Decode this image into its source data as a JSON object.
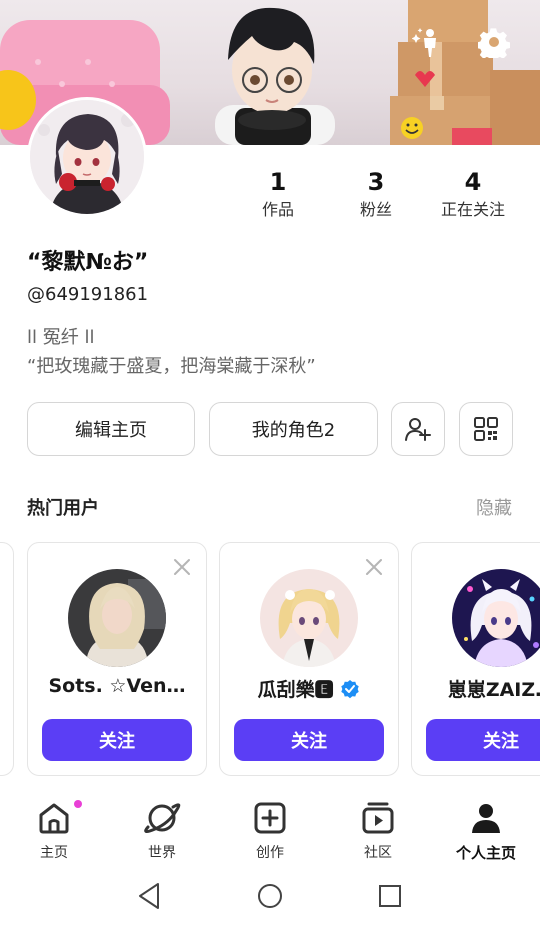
{
  "header": {
    "banner_alt": "avatar-scene-banner"
  },
  "profile": {
    "stats": [
      {
        "value": "1",
        "label": "作品"
      },
      {
        "value": "3",
        "label": "粉丝"
      },
      {
        "value": "4",
        "label": "正在关注"
      }
    ],
    "display_name": "“黎默№お”",
    "handle": "@649191861",
    "bio_line1": "ll 冤纤 ll",
    "bio_line2": "“把玫瑰藏于盛夏，把海棠藏于深秋”"
  },
  "actions": {
    "edit_profile": "编辑主页",
    "my_characters": "我的角色2"
  },
  "hot_users": {
    "title": "热门用户",
    "hide_label": "隐藏",
    "cards": [
      {
        "name": "Sots. ☆Ven…",
        "follow": "关注"
      },
      {
        "name": "瓜刮樂🅴",
        "follow": "关注"
      },
      {
        "name": "崽崽ZAIZ…",
        "follow": "关注"
      }
    ]
  },
  "nav": {
    "items": [
      {
        "label": "主页"
      },
      {
        "label": "世界"
      },
      {
        "label": "创作"
      },
      {
        "label": "社区"
      },
      {
        "label": "个人主页"
      }
    ]
  },
  "colors": {
    "accent": "#5b3ef5",
    "badge_dot": "#e93fd6",
    "verified": "#1d8ef5"
  }
}
